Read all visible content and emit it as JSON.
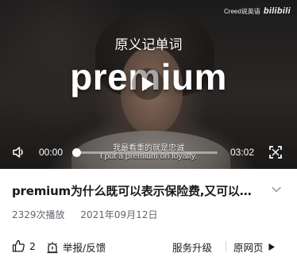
{
  "video": {
    "watermark_text": "Creed说英语",
    "watermark_brand": "bilibili",
    "overlay_title": "原义记单词",
    "overlay_word": "premium",
    "subtitle_cn": "我最看重的就是忠诚",
    "subtitle_en": "I put a premium on loyalty.",
    "current_time": "00:00",
    "duration": "03:02",
    "progress_fraction": 0.0
  },
  "info": {
    "title": "premium为什么既可以表示保险费,又可以表示溢价?",
    "views": "2329次播放",
    "date": "2021年09月12日"
  },
  "actions": {
    "like_count": "2",
    "report_label": "举报/反馈",
    "upgrade_label": "服务升级",
    "webpage_label": "原网页"
  },
  "icons": {
    "volume": "volume-icon",
    "play": "play-icon",
    "fullscreen": "fullscreen-icon",
    "expand": "chevron-down-icon",
    "like": "thumbs-up-icon",
    "report": "report-icon",
    "webpage": "play-triangle-icon"
  },
  "colors": {
    "text_primary": "#18191c",
    "text_secondary": "#61666d"
  }
}
